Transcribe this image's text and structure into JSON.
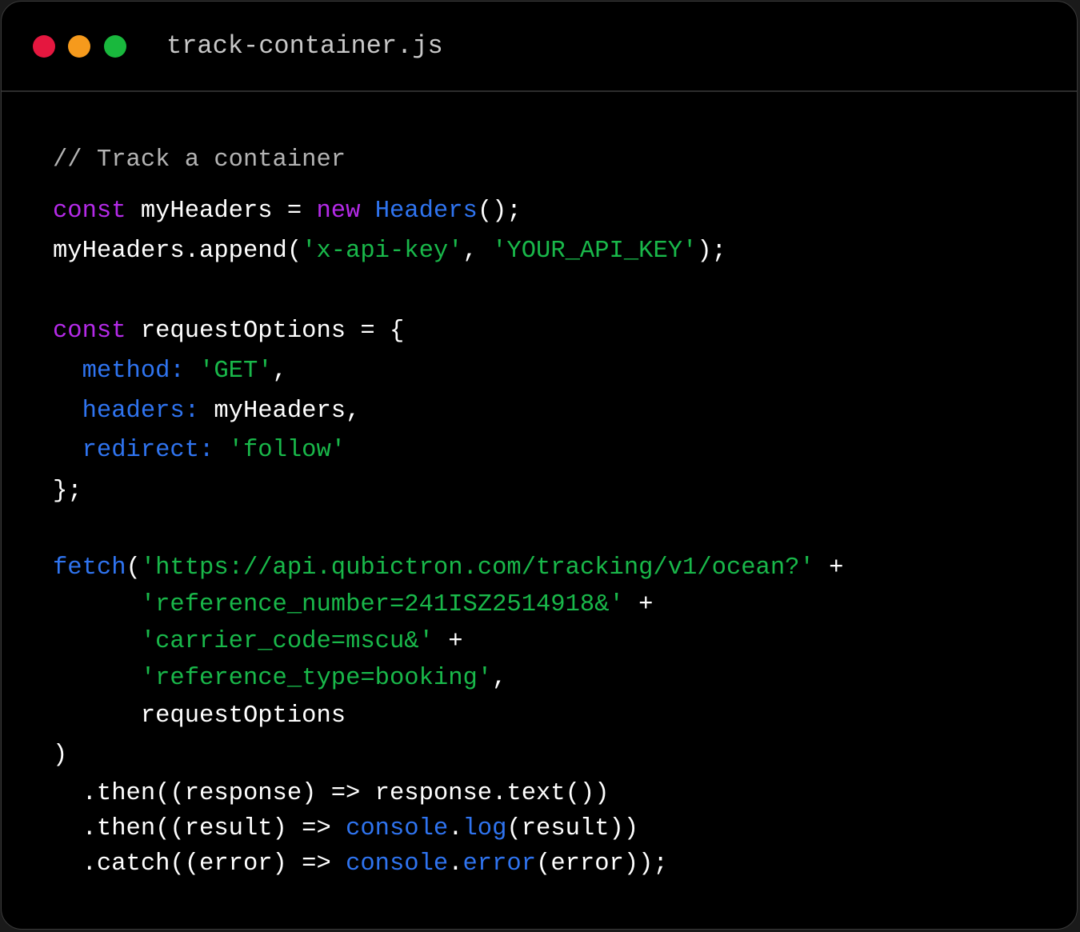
{
  "window": {
    "filename": "track-container.js",
    "dots": {
      "close_color": "#e5173f",
      "minimize_color": "#f69a1c",
      "maximize_color": "#19b83d"
    }
  },
  "colors": {
    "background": "#000000",
    "comment": "#b4b4b4",
    "keyword": "#b42ae8",
    "function": "#2f74f0",
    "string": "#19b84a",
    "plain": "#ffffff"
  },
  "code": {
    "lines": [
      [
        {
          "t": "// Track a container",
          "c": "comment"
        }
      ],
      [
        {
          "t": "const",
          "c": "keyword"
        },
        {
          "t": " myHeaders = ",
          "c": "plain"
        },
        {
          "t": "new",
          "c": "keyword"
        },
        {
          "t": " ",
          "c": "plain"
        },
        {
          "t": "Headers",
          "c": "fn"
        },
        {
          "t": "();",
          "c": "plain"
        }
      ],
      [
        {
          "t": "myHeaders.append(",
          "c": "plain"
        },
        {
          "t": "'x-api-key'",
          "c": "string"
        },
        {
          "t": ", ",
          "c": "plain"
        },
        {
          "t": "'YOUR_API_KEY'",
          "c": "string"
        },
        {
          "t": ");",
          "c": "plain"
        }
      ],
      [
        {
          "t": "const",
          "c": "keyword"
        },
        {
          "t": " requestOptions = {",
          "c": "plain"
        }
      ],
      [
        {
          "t": "  ",
          "c": "plain"
        },
        {
          "t": "method:",
          "c": "prop"
        },
        {
          "t": " ",
          "c": "plain"
        },
        {
          "t": "'GET'",
          "c": "string"
        },
        {
          "t": ",",
          "c": "plain"
        }
      ],
      [
        {
          "t": "  ",
          "c": "plain"
        },
        {
          "t": "headers:",
          "c": "prop"
        },
        {
          "t": " myHeaders,",
          "c": "plain"
        }
      ],
      [
        {
          "t": "  ",
          "c": "plain"
        },
        {
          "t": "redirect:",
          "c": "prop"
        },
        {
          "t": " ",
          "c": "plain"
        },
        {
          "t": "'follow'",
          "c": "string"
        }
      ],
      [
        {
          "t": "};",
          "c": "plain"
        }
      ],
      [
        {
          "t": "fetch",
          "c": "fn"
        },
        {
          "t": "(",
          "c": "plain"
        },
        {
          "t": "'https://api.qubictron.com/tracking/v1/ocean?'",
          "c": "string"
        },
        {
          "t": " +",
          "c": "plain"
        }
      ],
      [
        {
          "t": "      ",
          "c": "plain"
        },
        {
          "t": "'reference_number=241ISZ2514918&'",
          "c": "string"
        },
        {
          "t": " +",
          "c": "plain"
        }
      ],
      [
        {
          "t": "      ",
          "c": "plain"
        },
        {
          "t": "'carrier_code=mscu&'",
          "c": "string"
        },
        {
          "t": " +",
          "c": "plain"
        }
      ],
      [
        {
          "t": "      ",
          "c": "plain"
        },
        {
          "t": "'reference_type=booking'",
          "c": "string"
        },
        {
          "t": ",",
          "c": "plain"
        }
      ],
      [
        {
          "t": "      requestOptions",
          "c": "plain"
        }
      ],
      [
        {
          "t": ")",
          "c": "plain"
        }
      ],
      [
        {
          "t": "  .then((response) => response.text())",
          "c": "plain"
        }
      ],
      [
        {
          "t": "  .then((result) => ",
          "c": "plain"
        },
        {
          "t": "console",
          "c": "fn"
        },
        {
          "t": ".",
          "c": "plain"
        },
        {
          "t": "log",
          "c": "fn"
        },
        {
          "t": "(result))",
          "c": "plain"
        }
      ],
      [
        {
          "t": "  .catch((error) => ",
          "c": "plain"
        },
        {
          "t": "console",
          "c": "fn"
        },
        {
          "t": ".",
          "c": "plain"
        },
        {
          "t": "error",
          "c": "fn"
        },
        {
          "t": "(error));",
          "c": "plain"
        }
      ]
    ]
  }
}
